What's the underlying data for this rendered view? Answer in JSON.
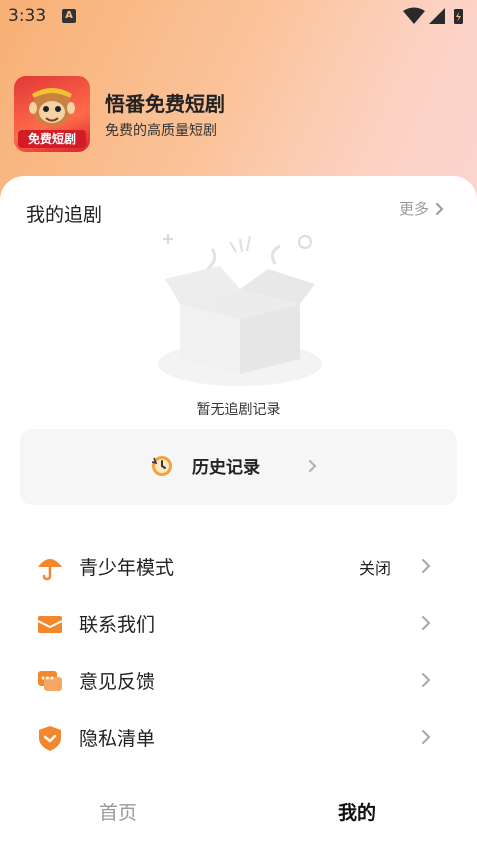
{
  "status_bar": {
    "time": "3:33",
    "notification_icon": "A"
  },
  "app": {
    "name": "悟番免费短剧",
    "slogan": "免费的高质量短剧",
    "icon_tag": "免费短剧"
  },
  "following": {
    "title": "我的追剧",
    "more_label": "更多",
    "empty_text": "暂无追剧记录"
  },
  "history": {
    "label": "历史记录"
  },
  "menu": {
    "items": [
      {
        "label": "青少年模式",
        "value": "关闭",
        "icon": "umbrella-icon"
      },
      {
        "label": "联系我们",
        "value": "",
        "icon": "envelope-icon"
      },
      {
        "label": "意见反馈",
        "value": "",
        "icon": "chat-icon"
      },
      {
        "label": "隐私清单",
        "value": "",
        "icon": "shield-icon"
      }
    ]
  },
  "tabs": {
    "home": "首页",
    "mine": "我的"
  },
  "colors": {
    "accent": "#f2872b",
    "gradient_start": "#f7b074",
    "gradient_end": "#fbd6d2"
  }
}
